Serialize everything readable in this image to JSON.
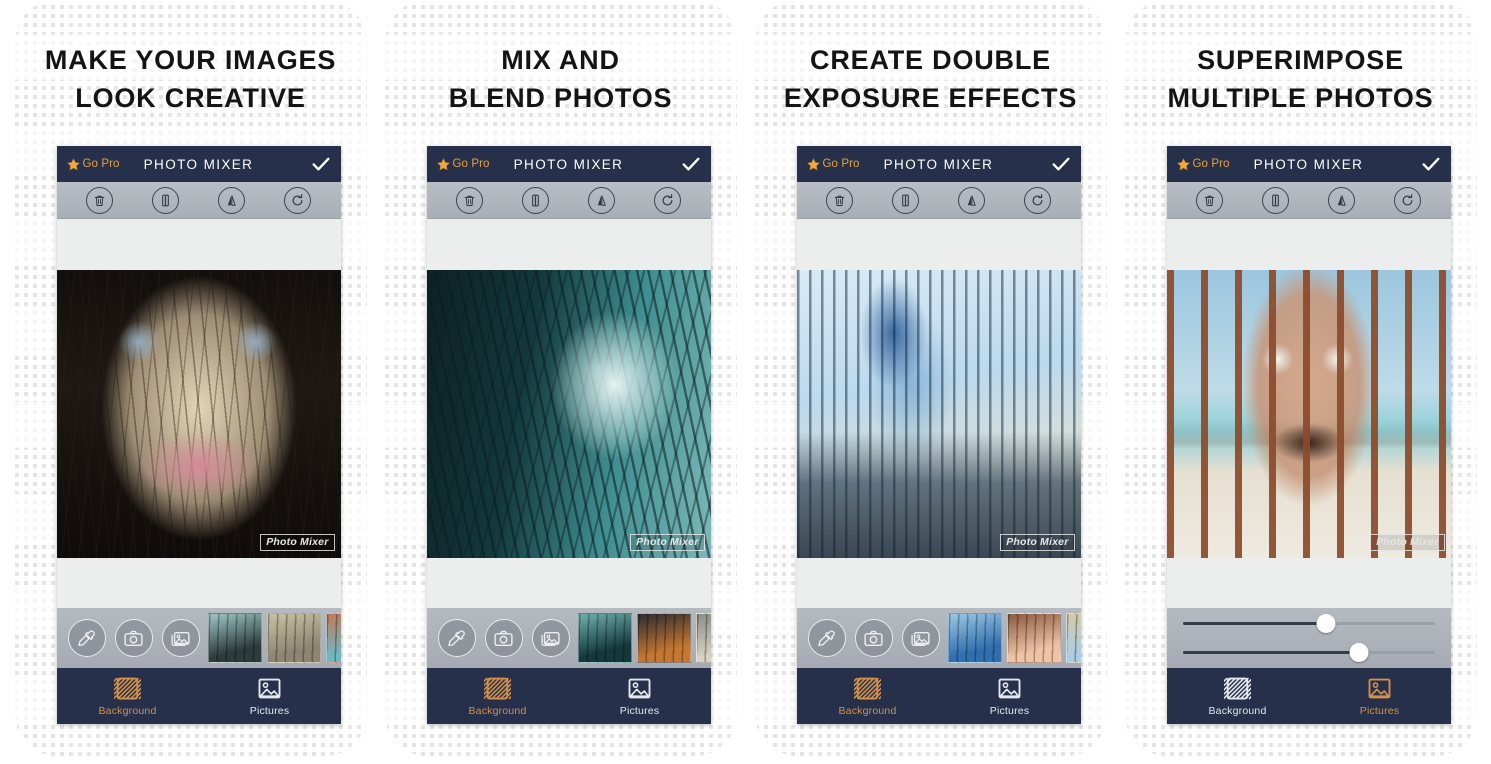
{
  "app": {
    "name": "PHOTO MIXER",
    "watermark": "Photo Mixer",
    "go_pro_label": "Go Pro",
    "accent_orange": "#d4914a",
    "navbar_color": "#26304a",
    "toolbar_color": "#aeb3ba",
    "page_background": "#f3f3f3"
  },
  "toolbar": {
    "icons": [
      {
        "name": "delete-icon",
        "label": "Delete"
      },
      {
        "name": "flip-vertical-icon",
        "label": "Flip Vertical"
      },
      {
        "name": "flip-horizontal-icon",
        "label": "Flip Horizontal"
      },
      {
        "name": "rotate-icon",
        "label": "Rotate"
      }
    ]
  },
  "strip_actions": [
    {
      "name": "eyedropper-icon",
      "label": "Color Picker"
    },
    {
      "name": "camera-icon",
      "label": "Camera"
    },
    {
      "name": "gallery-icon",
      "label": "Gallery"
    }
  ],
  "tabs": [
    {
      "name": "background",
      "label": "Background",
      "icon": "hatch-square-icon"
    },
    {
      "name": "pictures",
      "label": "Pictures",
      "icon": "picture-icon"
    }
  ],
  "panels": [
    {
      "id": "panel-1",
      "headline": [
        "MAKE YOUR IMAGES",
        "LOOK CREATIVE"
      ],
      "artwork": {
        "name": "double-exposure-face-trees",
        "description": "Double exposure of a woman's face blended with bare winter trees",
        "palette": [
          "#1b1713",
          "#ded1b4",
          "#8a9fb2",
          "#d88fa0"
        ]
      },
      "bottom_control": "thumbnails",
      "thumbnails": [
        {
          "name": "thumb-forest",
          "palette": [
            "#2d3b3c",
            "#9ec8c6"
          ]
        },
        {
          "name": "thumb-mountain-road",
          "palette": [
            "#8d8572",
            "#c9c2a4"
          ]
        },
        {
          "name": "thumb-partial",
          "palette": [
            "#6fb8c4",
            "#c07a5a"
          ]
        }
      ],
      "active_tab": "background"
    },
    {
      "id": "panel-2",
      "headline": [
        "MIX AND",
        "BLEND PHOTOS"
      ],
      "artwork": {
        "name": "double-exposure-face-forest-teal",
        "description": "Teal toned double exposure of a face blended with dark forest and a lone figure",
        "palette": [
          "#0f2225",
          "#8fc4c3",
          "#dff0ee"
        ]
      },
      "bottom_control": "thumbnails",
      "thumbnails": [
        {
          "name": "thumb-teal-forest",
          "palette": [
            "#14383c",
            "#6fb0ae"
          ]
        },
        {
          "name": "thumb-sunset-road",
          "palette": [
            "#c4772f",
            "#2a2a33"
          ]
        },
        {
          "name": "thumb-partial",
          "palette": [
            "#d7d2c2",
            "#8b8d86"
          ]
        }
      ],
      "active_tab": "background"
    },
    {
      "id": "panel-3",
      "headline": [
        "CREATE DOUBLE",
        "EXPOSURE EFFECTS"
      ],
      "artwork": {
        "name": "double-exposure-woman-pier-blue",
        "description": "Blue toned double exposure of a woman blended with a seaside pier pavilion",
        "palette": [
          "#cfe6f2",
          "#3b6ea8",
          "#1d3550",
          "#f0ead2"
        ]
      },
      "bottom_control": "thumbnails",
      "thumbnails": [
        {
          "name": "thumb-blue-pier",
          "palette": [
            "#2f6fae",
            "#9dc8e6"
          ]
        },
        {
          "name": "thumb-colosseum",
          "palette": [
            "#f0c3a6",
            "#8a5a3c"
          ]
        },
        {
          "name": "thumb-partial",
          "palette": [
            "#a9cfe4",
            "#d8c8a8"
          ]
        }
      ],
      "active_tab": "background"
    },
    {
      "id": "panel-4",
      "headline": [
        "SUPERIMPOSE",
        "MULTIPLE PHOTOS"
      ],
      "artwork": {
        "name": "superimposed-face-boardwalk",
        "description": "Surprised man's face superimposed over a seaside boardwalk pier with a red figure",
        "palette": [
          "#9dc5dd",
          "#d8a98e",
          "#8a4a2a",
          "#e8e4dc"
        ]
      },
      "bottom_control": "sliders",
      "sliders": [
        {
          "name": "opacity-slider",
          "value": 57
        },
        {
          "name": "blend-slider",
          "value": 70
        }
      ],
      "active_tab": "pictures"
    }
  ]
}
